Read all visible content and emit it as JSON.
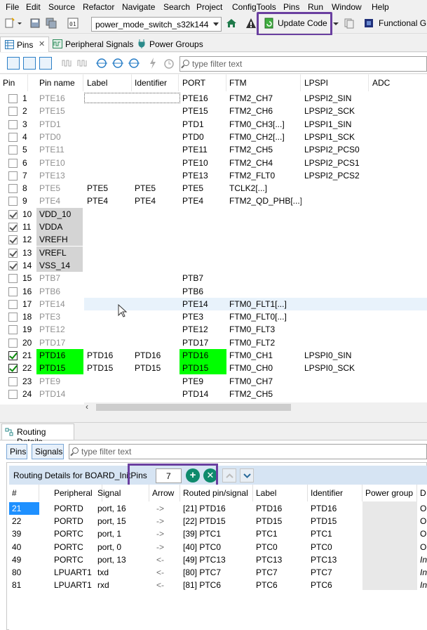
{
  "menu": [
    "File",
    "Edit",
    "Source",
    "Refactor",
    "Navigate",
    "Search",
    "Project",
    "ConfigTools",
    "Pins",
    "Run",
    "Window",
    "Help"
  ],
  "toolbar": {
    "project_combo": "power_mode_switch_s32k144",
    "update_code": "Update Code",
    "functional_group": "Functional G"
  },
  "tabs": [
    "Pins",
    "Peripheral Signals",
    "Power Groups"
  ],
  "pins_filter_placeholder": "type filter text",
  "pins_columns": [
    "Pin",
    "Pin name",
    "Label",
    "Identifier",
    "PORT",
    "FTM",
    "LPSPI",
    "ADC"
  ],
  "pins_rows": [
    {
      "pin": "1",
      "name": "PTE16",
      "label": "",
      "id": "",
      "port": "PTE16",
      "ftm": "FTM2_CH7",
      "lpspi": "LPSPI2_SIN",
      "state": "off"
    },
    {
      "pin": "2",
      "name": "PTE15",
      "label": "",
      "id": "",
      "port": "PTE15",
      "ftm": "FTM2_CH6",
      "lpspi": "LPSPI2_SCK",
      "state": "off"
    },
    {
      "pin": "3",
      "name": "PTD1",
      "label": "",
      "id": "",
      "port": "PTD1",
      "ftm": "FTM0_CH3[...]",
      "lpspi": "LPSPI1_SIN",
      "state": "off"
    },
    {
      "pin": "4",
      "name": "PTD0",
      "label": "",
      "id": "",
      "port": "PTD0",
      "ftm": "FTM0_CH2[...]",
      "lpspi": "LPSPI1_SCK",
      "state": "off"
    },
    {
      "pin": "5",
      "name": "PTE11",
      "label": "",
      "id": "",
      "port": "PTE11",
      "ftm": "FTM2_CH5",
      "lpspi": "LPSPI2_PCS0",
      "state": "off"
    },
    {
      "pin": "6",
      "name": "PTE10",
      "label": "",
      "id": "",
      "port": "PTE10",
      "ftm": "FTM2_CH4",
      "lpspi": "LPSPI2_PCS1",
      "state": "off"
    },
    {
      "pin": "7",
      "name": "PTE13",
      "label": "",
      "id": "",
      "port": "PTE13",
      "ftm": "FTM2_FLT0",
      "lpspi": "LPSPI2_PCS2",
      "state": "off"
    },
    {
      "pin": "8",
      "name": "PTE5",
      "label": "PTE5",
      "id": "PTE5",
      "port": "PTE5",
      "ftm": "TCLK2[...]",
      "lpspi": "",
      "state": "off"
    },
    {
      "pin": "9",
      "name": "PTE4",
      "label": "PTE4",
      "id": "PTE4",
      "port": "PTE4",
      "ftm": "FTM2_QD_PHB[...]",
      "lpspi": "",
      "state": "off"
    },
    {
      "pin": "10",
      "name": "VDD_10",
      "label": "",
      "id": "",
      "port": "",
      "ftm": "",
      "lpspi": "",
      "state": "power"
    },
    {
      "pin": "11",
      "name": "VDDA",
      "label": "",
      "id": "",
      "port": "",
      "ftm": "",
      "lpspi": "",
      "state": "power"
    },
    {
      "pin": "12",
      "name": "VREFH",
      "label": "",
      "id": "",
      "port": "",
      "ftm": "",
      "lpspi": "",
      "state": "power"
    },
    {
      "pin": "13",
      "name": "VREFL",
      "label": "",
      "id": "",
      "port": "",
      "ftm": "",
      "lpspi": "",
      "state": "power"
    },
    {
      "pin": "14",
      "name": "VSS_14",
      "label": "",
      "id": "",
      "port": "",
      "ftm": "",
      "lpspi": "",
      "state": "power"
    },
    {
      "pin": "15",
      "name": "PTB7",
      "label": "",
      "id": "",
      "port": "PTB7",
      "ftm": "",
      "lpspi": "",
      "state": "off"
    },
    {
      "pin": "16",
      "name": "PTB6",
      "label": "",
      "id": "",
      "port": "PTB6",
      "ftm": "",
      "lpspi": "",
      "state": "off"
    },
    {
      "pin": "17",
      "name": "PTE14",
      "label": "",
      "id": "",
      "port": "PTE14",
      "ftm": "FTM0_FLT1[...]",
      "lpspi": "",
      "state": "hover"
    },
    {
      "pin": "18",
      "name": "PTE3",
      "label": "",
      "id": "",
      "port": "PTE3",
      "ftm": "FTM0_FLT0[...]",
      "lpspi": "",
      "state": "off"
    },
    {
      "pin": "19",
      "name": "PTE12",
      "label": "",
      "id": "",
      "port": "PTE12",
      "ftm": "FTM0_FLT3",
      "lpspi": "",
      "state": "off"
    },
    {
      "pin": "20",
      "name": "PTD17",
      "label": "",
      "id": "",
      "port": "PTD17",
      "ftm": "FTM0_FLT2",
      "lpspi": "",
      "state": "off"
    },
    {
      "pin": "21",
      "name": "PTD16",
      "label": "PTD16",
      "id": "PTD16",
      "port": "PTD16",
      "ftm": "FTM0_CH1",
      "lpspi": "LPSPI0_SIN",
      "state": "routed"
    },
    {
      "pin": "22",
      "name": "PTD15",
      "label": "PTD15",
      "id": "PTD15",
      "port": "PTD15",
      "ftm": "FTM0_CH0",
      "lpspi": "LPSPI0_SCK",
      "state": "routed"
    },
    {
      "pin": "23",
      "name": "PTE9",
      "label": "",
      "id": "",
      "port": "PTE9",
      "ftm": "FTM0_CH7",
      "lpspi": "",
      "state": "off"
    },
    {
      "pin": "24",
      "name": "PTD14",
      "label": "",
      "id": "",
      "port": "PTD14",
      "ftm": "FTM2_CH5",
      "lpspi": "",
      "state": "off"
    }
  ],
  "routing": {
    "tab_title": "Routing Details",
    "pins_btn": "Pins",
    "signals_btn": "Signals",
    "filter_placeholder": "type filter text",
    "header_title": "Routing Details for BOARD_InitPins",
    "count": "7",
    "columns": [
      "#",
      "Peripheral",
      "Signal",
      "Arrow",
      "Routed pin/signal",
      "Label",
      "Identifier",
      "Power group",
      "D"
    ],
    "rows": [
      {
        "n": "21",
        "periph": "PORTD",
        "signal": "port, 16",
        "arrow": "->",
        "routed": "[21] PTD16",
        "label": "PTD16",
        "id": "PTD16",
        "dir": "O"
      },
      {
        "n": "22",
        "periph": "PORTD",
        "signal": "port, 15",
        "arrow": "->",
        "routed": "[22] PTD15",
        "label": "PTD15",
        "id": "PTD15",
        "dir": "O"
      },
      {
        "n": "39",
        "periph": "PORTC",
        "signal": "port, 1",
        "arrow": "->",
        "routed": "[39] PTC1",
        "label": "PTC1",
        "id": "PTC1",
        "dir": "O"
      },
      {
        "n": "40",
        "periph": "PORTC",
        "signal": "port, 0",
        "arrow": "->",
        "routed": "[40] PTC0",
        "label": "PTC0",
        "id": "PTC0",
        "dir": "O"
      },
      {
        "n": "49",
        "periph": "PORTC",
        "signal": "port, 13",
        "arrow": "<-",
        "routed": "[49] PTC13",
        "label": "PTC13",
        "id": "PTC13",
        "dir": "In"
      },
      {
        "n": "80",
        "periph": "LPUART1",
        "signal": "txd",
        "arrow": "<-",
        "routed": "[80] PTC7",
        "label": "PTC7",
        "id": "PTC7",
        "dir": "In"
      },
      {
        "n": "81",
        "periph": "LPUART1",
        "signal": "rxd",
        "arrow": "<-",
        "routed": "[81] PTC6",
        "label": "PTC6",
        "id": "PTC6",
        "dir": "In"
      }
    ]
  },
  "colors": {
    "accent_outline": "#6a3fa0",
    "routed_green": "#00ff00",
    "selected_blue": "#1e90ff"
  }
}
